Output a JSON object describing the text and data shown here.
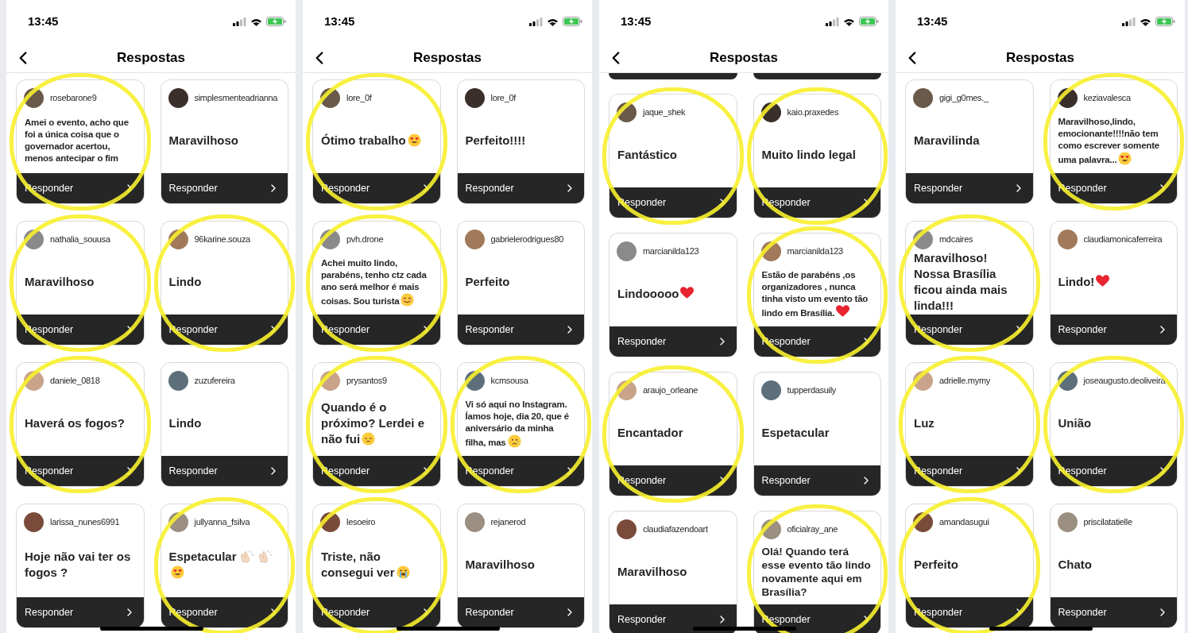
{
  "phones": [
    {
      "time": "13:45",
      "title": "Respostas",
      "scrolled_top": false,
      "cards": [
        {
          "user": "rosebarone9",
          "text": "Amei o evento, acho que foi a única coisa que o governador acertou, menos antecipar o fim",
          "kind": "long",
          "circled": true,
          "reply": "Responder"
        },
        {
          "user": "simplesmenteadrianna",
          "text": "Maravilhoso",
          "kind": "short",
          "circled": false,
          "reply": "Responder"
        },
        {
          "user": "nathalia_souusa",
          "text": "Maravilhoso",
          "kind": "short",
          "circled": true,
          "reply": "Responder"
        },
        {
          "user": "96karine.souza",
          "text": "Lindo",
          "kind": "short",
          "circled": true,
          "reply": "Responder"
        },
        {
          "user": "daniele_0818",
          "text": "Haverá os fogos?",
          "kind": "short",
          "circled": true,
          "reply": "Responder"
        },
        {
          "user": "zuzufereira",
          "text": "Lindo",
          "kind": "short",
          "circled": false,
          "reply": "Responder"
        },
        {
          "user": "larissa_nunes6991",
          "text": "Hoje não vai ter os fogos ?",
          "kind": "short",
          "circled": false,
          "reply": "Responder"
        },
        {
          "user": "jullyanna_fsilva",
          "text": "Espetacular",
          "kind": "short",
          "emojis": [
            {
              "kind": "clap"
            },
            {
              "kind": "clap"
            },
            {
              "kind": "heart_eyes"
            }
          ],
          "circled": true,
          "reply": "Responder"
        }
      ]
    },
    {
      "time": "13:45",
      "title": "Respostas",
      "scrolled_top": false,
      "cards": [
        {
          "user": "lore_0f",
          "text": "Ótimo trabalho",
          "kind": "short",
          "emojis": [
            {
              "kind": "heart_eyes"
            }
          ],
          "circled": true,
          "reply": "Responder"
        },
        {
          "user": "lore_0f",
          "text": "Perfeito!!!!",
          "kind": "short",
          "circled": false,
          "reply": "Responder"
        },
        {
          "user": "pvh.drone",
          "text": "Achei muito lindo, parabéns, tenho ctz cada ano será melhor é mais coisas. Sou turista",
          "kind": "long",
          "emojis": [
            {
              "kind": "smile"
            }
          ],
          "circled": true,
          "reply": "Responder"
        },
        {
          "user": "gabrielerodrigues80",
          "text": "Perfeito",
          "kind": "short",
          "circled": false,
          "reply": "Responder"
        },
        {
          "user": "prysantos9",
          "text": "Quando é o próximo? Lerdei e não fui",
          "kind": "short",
          "emojis": [
            {
              "kind": "pensive"
            }
          ],
          "circled": true,
          "reply": "Responder"
        },
        {
          "user": "kcmsousa",
          "text": "Vi só aqui no Instagram. Íamos hoje, dia 20, que é aniversário da minha filha, mas",
          "kind": "long",
          "emojis": [
            {
              "kind": "sad_tear"
            }
          ],
          "circled": true,
          "reply": "Responder"
        },
        {
          "user": "lesoeiro",
          "text": "Triste, não consegui ver",
          "kind": "short",
          "emojis": [
            {
              "kind": "sob"
            }
          ],
          "circled": true,
          "reply": "Responder"
        },
        {
          "user": "rejanerod",
          "text": "Maravilhoso",
          "kind": "short",
          "circled": false,
          "reply": "Responder"
        }
      ]
    },
    {
      "time": "13:45",
      "title": "Respostas",
      "scrolled_top": true,
      "cards": [
        {
          "user": "jaque_shek",
          "text": "Fantástico",
          "kind": "short",
          "circled": true,
          "reply": "Responder"
        },
        {
          "user": "kaio.praxedes",
          "text": "Muito lindo legal",
          "kind": "short",
          "circled": true,
          "reply": "Responder"
        },
        {
          "user": "marcianilda123",
          "text": "Lindooooo",
          "kind": "short",
          "emojis": [
            {
              "kind": "heart"
            }
          ],
          "circled": false,
          "reply": "Responder"
        },
        {
          "user": "marcianilda123",
          "text": "Estão de parabéns ,os organizadores , nunca tinha visto um evento tão lindo em  Brasília.",
          "kind": "long",
          "emojis": [
            {
              "kind": "heart"
            }
          ],
          "circled": true,
          "reply": "Responder"
        },
        {
          "user": "araujo_orleane",
          "text": "Encantador",
          "kind": "short",
          "circled": true,
          "reply": "Responder"
        },
        {
          "user": "tupperdasuily",
          "text": "Espetacular",
          "kind": "short",
          "circled": false,
          "reply": "Responder"
        },
        {
          "user": "claudiafazendoart",
          "text": "Maravilhoso",
          "kind": "short",
          "circled": false,
          "reply": "Responder"
        },
        {
          "user": "oficialray_ane",
          "text": "Olá! Quando terá esse evento tão lindo novamente aqui em Brasília?",
          "kind": "medium",
          "circled": true,
          "reply": "Responder"
        }
      ]
    },
    {
      "time": "13:45",
      "title": "Respostas",
      "scrolled_top": false,
      "cards": [
        {
          "user": "gigi_g0mes._",
          "text": "Maravilinda",
          "kind": "short",
          "circled": false,
          "reply": "Responder"
        },
        {
          "user": "keziavalesca",
          "text": "Maravilhoso,lindo, emocionante!!!!não tem como escrever somente uma palavra...",
          "kind": "long",
          "emojis": [
            {
              "kind": "heart_eyes"
            }
          ],
          "circled": true,
          "reply": "Responder"
        },
        {
          "user": "mdcaires",
          "text": "Maravilhoso! Nossa Brasília ficou ainda mais linda!!!",
          "kind": "short",
          "circled": true,
          "reply": "Responder"
        },
        {
          "user": "claudiamonicaferreira",
          "text": "Lindo!",
          "kind": "short",
          "emojis": [
            {
              "kind": "heart"
            }
          ],
          "circled": false,
          "reply": "Responder"
        },
        {
          "user": "adrielle.mymy",
          "text": "Luz",
          "kind": "short",
          "circled": true,
          "reply": "Responder"
        },
        {
          "user": "joseaugusto.deoliveira",
          "text": "União",
          "kind": "short",
          "circled": true,
          "reply": "Responder"
        },
        {
          "user": "amandasugui",
          "text": "Perfeito",
          "kind": "short",
          "circled": true,
          "reply": "Responder"
        },
        {
          "user": "priscilatatielle",
          "text": "Chato",
          "kind": "short",
          "circled": false,
          "reply": "Responder"
        }
      ]
    }
  ]
}
